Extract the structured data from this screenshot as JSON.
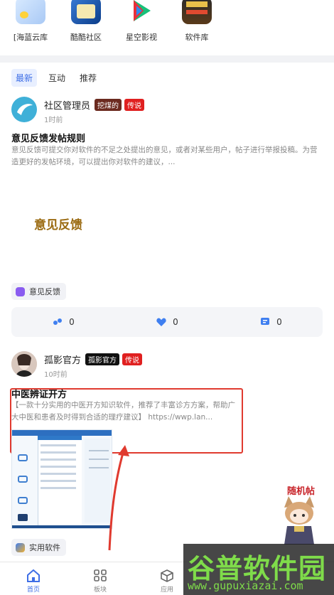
{
  "apps": [
    {
      "label": "[海蓝云库",
      "icon": "app-blue-cloud-icon"
    },
    {
      "label": "酷酷社区",
      "icon": "app-cool-community-icon"
    },
    {
      "label": "星空影视",
      "icon": "app-star-video-icon"
    },
    {
      "label": "软件库",
      "icon": "app-software-library-icon"
    }
  ],
  "tabs": [
    "最新",
    "互动",
    "推荐"
  ],
  "post1": {
    "author": "社区管理员",
    "badge1": "挖煤的",
    "badge2": "传说",
    "time": "1时前",
    "title": "意见反馈发帖规则",
    "body": "意见反馈可提交你对软件的不足之处提出的意见，或者对某些用户，帖子进行举报投稿。为营造更好的发帖环境，可以提出你对软件的建议，...",
    "image_text": "意见反馈",
    "tag": "意见反馈"
  },
  "stats": {
    "steps": "0",
    "likes": "0",
    "comments": "0"
  },
  "post2": {
    "author": "孤影官方",
    "badge1": "孤影官方",
    "badge2": "传说",
    "time": "10时前",
    "title": "中医辨证开方",
    "body": "【一款十分实用的中医开方知识软件，推荐了丰富诊方方案，帮助广大中医和患者及时得到合适的理疗建议】 https://wwp.lan...",
    "tag": "实用软件",
    "sticker_text": "随机帖"
  },
  "nav": [
    {
      "label": "首页",
      "icon": "home-icon"
    },
    {
      "label": "板块",
      "icon": "grid-icon"
    },
    {
      "label": "应用",
      "icon": "cube-icon"
    },
    {
      "label": "",
      "icon": ""
    },
    {
      "label": "",
      "icon": ""
    }
  ],
  "watermark": {
    "big": "谷普软件园",
    "url": "www.gupuxiazai.com"
  },
  "colors": {
    "accent": "#3f6fe6",
    "badge_brown": "#6b2a1f",
    "badge_red": "#e02020",
    "annotation_red": "#e03a2f"
  }
}
